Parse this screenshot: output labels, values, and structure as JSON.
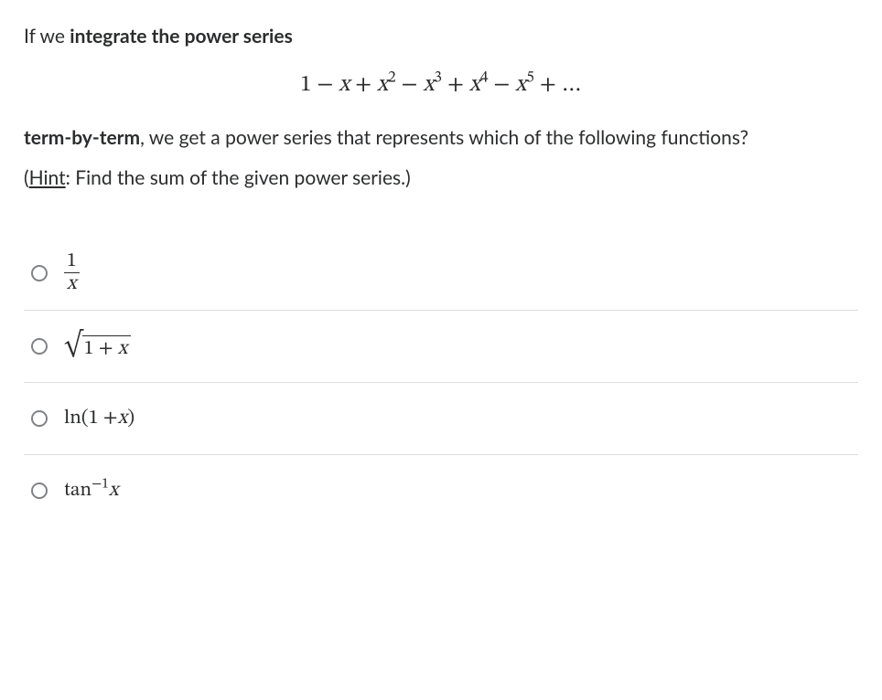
{
  "question": {
    "intro1_pre": "If we ",
    "intro1_bold": "integrate the power series",
    "formula_html": "1 − <span class='ital'>x</span> + <span class='ital'>x</span><sup>2</sup> − <span class='ital'>x</span><sup>3</sup> + <span class='ital'>x</span><sup>4</sup> − <span class='ital'>x</span><sup>5</sup> + …",
    "intro2_bold": "term-by-term",
    "intro2_post": ", we get a power series that represents which of the following functions?",
    "hint_label": "Hint",
    "hint_text": ": Find the sum of the given power series.)"
  },
  "options": [
    {
      "id": "opt-1-over-x",
      "type": "fraction",
      "num": "1",
      "den": "x"
    },
    {
      "id": "opt-sqrt-1-plus-x",
      "type": "sqrt",
      "body": "1 + x"
    },
    {
      "id": "opt-ln-1-plus-x",
      "type": "plain",
      "text": "ln(1 + x)"
    },
    {
      "id": "opt-arctan-x",
      "type": "sup",
      "pre": "tan",
      "sup": "−1",
      "post": "x"
    }
  ]
}
